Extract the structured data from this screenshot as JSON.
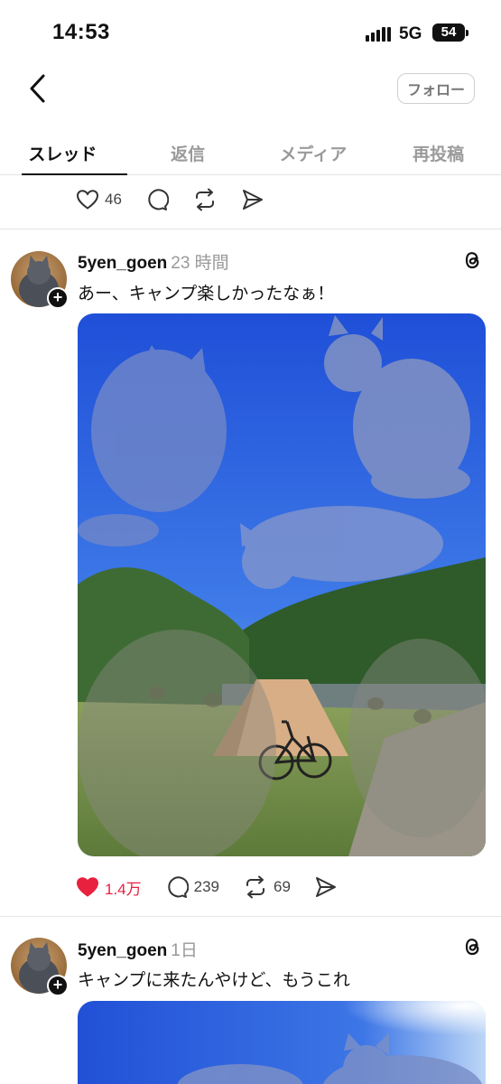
{
  "status": {
    "time": "14:53",
    "network": "5G",
    "battery": "54"
  },
  "header": {
    "follow_label": "フォロー"
  },
  "tabs": [
    {
      "label": "スレッド",
      "active": true
    },
    {
      "label": "返信"
    },
    {
      "label": "メディア"
    },
    {
      "label": "再投稿"
    }
  ],
  "prev_post": {
    "likes": "46"
  },
  "posts": [
    {
      "username": "5yen_goen",
      "time": "23 時間",
      "text": "あー、キャンプ楽しかったなぁ！",
      "likes": "1.4万",
      "replies": "239",
      "reposts": "69",
      "liked": true
    },
    {
      "username": "5yen_goen",
      "time": "1日",
      "text": "キャンプに来たんやけど、もうこれ"
    }
  ],
  "colors": {
    "like_active": "#e8213f",
    "text_muted": "#999999",
    "border": "#e6e6e6"
  },
  "icons": [
    "back-chevron-icon",
    "heart-icon",
    "comment-icon",
    "repost-icon",
    "share-icon",
    "threads-logo-icon",
    "plus-icon"
  ]
}
